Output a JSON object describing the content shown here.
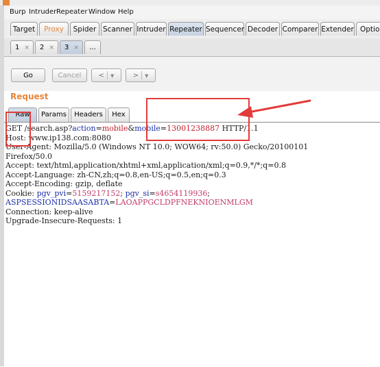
{
  "menubar": [
    "Burp",
    "Intruder",
    "Repeater",
    "Window",
    "Help"
  ],
  "tools": [
    "Target",
    "Proxy",
    "Spider",
    "Scanner",
    "Intruder",
    "Repeater",
    "Sequencer",
    "Decoder",
    "Comparer",
    "Extender",
    "Options"
  ],
  "active_tool": "Repeater",
  "repeater_tabs": [
    {
      "label": "1",
      "close": "×"
    },
    {
      "label": "2",
      "close": "×"
    },
    {
      "label": "3",
      "close": "×"
    }
  ],
  "repeater_tab_more": "...",
  "toolbar": {
    "go": "Go",
    "cancel": "Cancel",
    "back": "<",
    "forward": ">",
    "dropdown": "▼"
  },
  "request": {
    "title": "Request",
    "tabs": [
      "Raw",
      "Params",
      "Headers",
      "Hex"
    ],
    "active_tab": "Raw",
    "lines": {
      "l1": {
        "method": "GET /search.asp?",
        "p1_name": "action",
        "eq1": "=",
        "p1_value": "mobile",
        "amp": "&",
        "p2_name": "mobile",
        "eq2": "=",
        "p2_value": "13001238887",
        "proto": " HTTP/1.1"
      },
      "l2": "Host: www.ip138.com:8080",
      "l3": "User-Agent: Mozilla/5.0 (Windows NT 10.0; WOW64; rv:50.0) Gecko/20100101",
      "l4": "Firefox/50.0",
      "l5": "Accept: text/html,application/xhtml+xml,application/xml;q=0.9,*/*;q=0.8",
      "l6": "Accept-Language: zh-CN,zh;q=0.8,en-US;q=0.5,en;q=0.3",
      "l7": "Accept-Encoding: gzip, deflate",
      "l8": {
        "prefix": "Cookie: ",
        "c1_name": "pgv_pvi",
        "c1_eq": "=",
        "c1_value": "5159217152",
        "sep": "; ",
        "c2_name": "pgv_si",
        "c2_eq": "=",
        "c2_value": "s4654119936",
        "end": ";"
      },
      "l9": {
        "name": "ASPSESSIONIDSAASABTA",
        "eq": "=",
        "value": "LAOAPPGCLDPFNEKNIOENMLGM"
      },
      "l10": "Connection: keep-alive",
      "l11": "Upgrade-Insecure-Requests: 1"
    }
  },
  "colors": {
    "accent_orange": "#e8863a",
    "annotation_red": "#e23b3b",
    "param_blue": "#1b2ea8",
    "value_red": "#c0202a",
    "cookie_value": "#c23a68"
  }
}
